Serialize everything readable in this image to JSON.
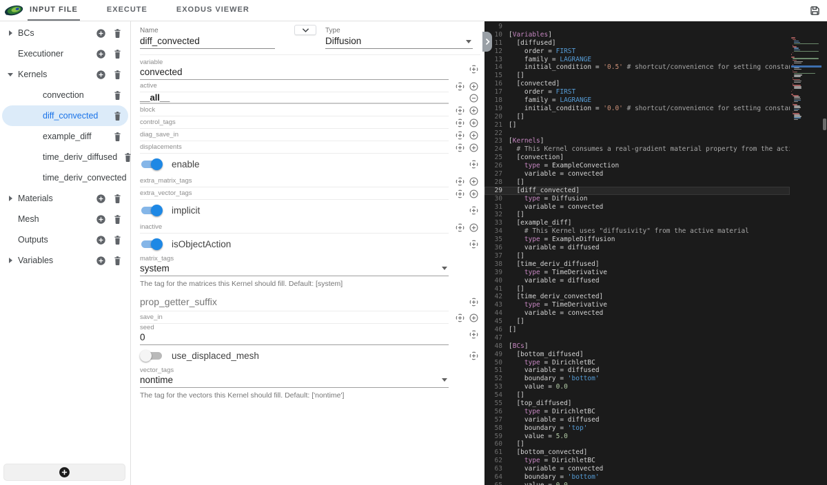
{
  "toolbar": {
    "tabs": [
      {
        "label": "INPUT FILE",
        "active": true
      },
      {
        "label": "EXECUTE",
        "active": false
      },
      {
        "label": "EXODUS VIEWER",
        "active": false
      }
    ],
    "save_icon": "save-icon"
  },
  "sidebar": {
    "items": [
      {
        "label": "BCs",
        "level": 0,
        "arrow": "right",
        "add": true,
        "trash": true,
        "selected": false
      },
      {
        "label": "Executioner",
        "level": 0,
        "arrow": null,
        "add": true,
        "trash": true,
        "selected": false
      },
      {
        "label": "Kernels",
        "level": 0,
        "arrow": "down",
        "add": true,
        "trash": true,
        "selected": false
      },
      {
        "label": "convection",
        "level": 1,
        "arrow": null,
        "add": false,
        "trash": true,
        "selected": false
      },
      {
        "label": "diff_convected",
        "level": 1,
        "arrow": null,
        "add": false,
        "trash": true,
        "selected": true
      },
      {
        "label": "example_diff",
        "level": 1,
        "arrow": null,
        "add": false,
        "trash": true,
        "selected": false
      },
      {
        "label": "time_deriv_diffused",
        "level": 1,
        "arrow": null,
        "add": false,
        "trash": true,
        "selected": false
      },
      {
        "label": "time_deriv_convected",
        "level": 1,
        "arrow": null,
        "add": false,
        "trash": true,
        "selected": false
      },
      {
        "label": "Materials",
        "level": 0,
        "arrow": "right",
        "add": true,
        "trash": true,
        "selected": false
      },
      {
        "label": "Mesh",
        "level": 0,
        "arrow": null,
        "add": true,
        "trash": true,
        "selected": false
      },
      {
        "label": "Outputs",
        "level": 0,
        "arrow": null,
        "add": true,
        "trash": true,
        "selected": false
      },
      {
        "label": "Variables",
        "level": 0,
        "arrow": "right",
        "add": true,
        "trash": true,
        "selected": false
      }
    ],
    "selected_color": "#1a73e8",
    "selected_bg": "#dcebf9"
  },
  "form": {
    "name": {
      "label": "Name",
      "value": "diff_convected"
    },
    "type": {
      "label": "Type",
      "value": "Diffusion"
    },
    "rows": [
      {
        "kind": "filled",
        "label": "variable",
        "value": "convected",
        "icons": [
          "target"
        ]
      },
      {
        "kind": "empty",
        "label": "active",
        "icons": [
          "target",
          "add"
        ]
      },
      {
        "kind": "item",
        "value": "__all__",
        "icons": [
          "remove"
        ]
      },
      {
        "kind": "empty",
        "label": "block",
        "icons": [
          "target",
          "add"
        ]
      },
      {
        "kind": "empty",
        "label": "control_tags",
        "icons": [
          "target",
          "add"
        ]
      },
      {
        "kind": "empty",
        "label": "diag_save_in",
        "icons": [
          "target",
          "add"
        ]
      },
      {
        "kind": "empty",
        "label": "displacements",
        "icons": [
          "target",
          "add"
        ]
      },
      {
        "kind": "toggle",
        "label": "enable",
        "on": true,
        "icons": [
          "target"
        ]
      },
      {
        "kind": "empty",
        "label": "extra_matrix_tags",
        "icons": [
          "target",
          "add"
        ]
      },
      {
        "kind": "empty",
        "label": "extra_vector_tags",
        "icons": [
          "target",
          "add"
        ]
      },
      {
        "kind": "toggle",
        "label": "implicit",
        "on": true,
        "icons": [
          "target"
        ]
      },
      {
        "kind": "empty",
        "label": "inactive",
        "icons": [
          "target",
          "add"
        ]
      },
      {
        "kind": "toggle",
        "label": "isObjectAction",
        "on": true,
        "icons": [
          "target"
        ]
      },
      {
        "kind": "select",
        "label": "matrix_tags",
        "value": "system",
        "helper": "The tag for the matrices this Kernel should fill. Default: [system]",
        "icons": []
      },
      {
        "kind": "placeholder",
        "label": "prop_getter_suffix",
        "icons": [
          "target"
        ]
      },
      {
        "kind": "empty",
        "label": "save_in",
        "icons": [
          "target",
          "add"
        ]
      },
      {
        "kind": "filled",
        "label": "seed",
        "value": "0",
        "icons": [
          "target"
        ]
      },
      {
        "kind": "toggle",
        "label": "use_displaced_mesh",
        "on": false,
        "icons": [
          "target"
        ]
      },
      {
        "kind": "select",
        "label": "vector_tags",
        "value": "nontime",
        "helper": "The tag for the vectors this Kernel should fill. Default: ['nontime']",
        "icons": []
      }
    ],
    "toggle_on_color": "#1e88e5"
  },
  "editor": {
    "background": "#1b1b1b",
    "current_line": 29,
    "token_colors": {
      "d": "#d4d4d4",
      "p": "#c586c0",
      "b": "#569cd6",
      "o": "#ce9178",
      "n": "#b5cea8",
      "c": "#a8a8a8"
    },
    "lines": [
      {
        "n": 9,
        "t": []
      },
      {
        "n": 10,
        "t": [
          [
            "[",
            "d"
          ],
          [
            "Variables",
            "p"
          ],
          [
            "]",
            "d"
          ]
        ]
      },
      {
        "n": 11,
        "t": [
          [
            "  [diffused]",
            "d"
          ]
        ]
      },
      {
        "n": 12,
        "t": [
          [
            "    order = ",
            "d"
          ],
          [
            "FIRST",
            "b"
          ]
        ]
      },
      {
        "n": 13,
        "t": [
          [
            "    family = ",
            "d"
          ],
          [
            "LAGRANGE",
            "b"
          ]
        ]
      },
      {
        "n": 14,
        "t": [
          [
            "    initial_condition = ",
            "d"
          ],
          [
            "'0.5'",
            "o"
          ],
          [
            " ",
            "d"
          ],
          [
            "# shortcut/convenience for setting constant initial condition",
            "c"
          ]
        ]
      },
      {
        "n": 15,
        "t": [
          [
            "  []",
            "d"
          ]
        ]
      },
      {
        "n": 16,
        "t": [
          [
            "  [convected]",
            "d"
          ]
        ]
      },
      {
        "n": 17,
        "t": [
          [
            "    order = ",
            "d"
          ],
          [
            "FIRST",
            "b"
          ]
        ]
      },
      {
        "n": 18,
        "t": [
          [
            "    family = ",
            "d"
          ],
          [
            "LAGRANGE",
            "b"
          ]
        ]
      },
      {
        "n": 19,
        "t": [
          [
            "    initial_condition = ",
            "d"
          ],
          [
            "'0.0'",
            "o"
          ],
          [
            " ",
            "d"
          ],
          [
            "# shortcut/convenience for setting constant initial condition",
            "c"
          ]
        ]
      },
      {
        "n": 20,
        "t": [
          [
            "  []",
            "d"
          ]
        ]
      },
      {
        "n": 21,
        "t": [
          [
            "[]",
            "d"
          ]
        ]
      },
      {
        "n": 22,
        "t": []
      },
      {
        "n": 23,
        "t": [
          [
            "[",
            "d"
          ],
          [
            "Kernels",
            "p"
          ],
          [
            "]",
            "d"
          ]
        ]
      },
      {
        "n": 24,
        "t": [
          [
            "  ",
            "d"
          ],
          [
            "# This Kernel consumes a real-gradient material property from the active material",
            "c"
          ]
        ]
      },
      {
        "n": 25,
        "t": [
          [
            "  [convection]",
            "d"
          ]
        ]
      },
      {
        "n": 26,
        "t": [
          [
            "    ",
            "d"
          ],
          [
            "type",
            "p"
          ],
          [
            " = ExampleConvection",
            "d"
          ]
        ]
      },
      {
        "n": 27,
        "t": [
          [
            "    variable = convected",
            "d"
          ]
        ]
      },
      {
        "n": 28,
        "t": [
          [
            "  []",
            "d"
          ]
        ]
      },
      {
        "n": 29,
        "t": [
          [
            "  [diff_convected]",
            "d"
          ]
        ]
      },
      {
        "n": 30,
        "t": [
          [
            "    ",
            "d"
          ],
          [
            "type",
            "p"
          ],
          [
            " = Diffusion",
            "d"
          ]
        ]
      },
      {
        "n": 31,
        "t": [
          [
            "    variable = convected",
            "d"
          ]
        ]
      },
      {
        "n": 32,
        "t": [
          [
            "  []",
            "d"
          ]
        ]
      },
      {
        "n": 33,
        "t": [
          [
            "  [example_diff]",
            "d"
          ]
        ]
      },
      {
        "n": 34,
        "t": [
          [
            "    ",
            "d"
          ],
          [
            "# This Kernel uses \"diffusivity\" from the active material",
            "c"
          ]
        ]
      },
      {
        "n": 35,
        "t": [
          [
            "    ",
            "d"
          ],
          [
            "type",
            "p"
          ],
          [
            " = ExampleDiffusion",
            "d"
          ]
        ]
      },
      {
        "n": 36,
        "t": [
          [
            "    variable = diffused",
            "d"
          ]
        ]
      },
      {
        "n": 37,
        "t": [
          [
            "  []",
            "d"
          ]
        ]
      },
      {
        "n": 38,
        "t": [
          [
            "  [time_deriv_diffused]",
            "d"
          ]
        ]
      },
      {
        "n": 39,
        "t": [
          [
            "    ",
            "d"
          ],
          [
            "type",
            "p"
          ],
          [
            " = TimeDerivative",
            "d"
          ]
        ]
      },
      {
        "n": 40,
        "t": [
          [
            "    variable = diffused",
            "d"
          ]
        ]
      },
      {
        "n": 41,
        "t": [
          [
            "  []",
            "d"
          ]
        ]
      },
      {
        "n": 42,
        "t": [
          [
            "  [time_deriv_convected]",
            "d"
          ]
        ]
      },
      {
        "n": 43,
        "t": [
          [
            "    ",
            "d"
          ],
          [
            "type",
            "p"
          ],
          [
            " = TimeDerivative",
            "d"
          ]
        ]
      },
      {
        "n": 44,
        "t": [
          [
            "    variable = convected",
            "d"
          ]
        ]
      },
      {
        "n": 45,
        "t": [
          [
            "  []",
            "d"
          ]
        ]
      },
      {
        "n": 46,
        "t": [
          [
            "[]",
            "d"
          ]
        ]
      },
      {
        "n": 47,
        "t": []
      },
      {
        "n": 48,
        "t": [
          [
            "[",
            "d"
          ],
          [
            "BCs",
            "p"
          ],
          [
            "]",
            "d"
          ]
        ]
      },
      {
        "n": 49,
        "t": [
          [
            "  [bottom_diffused]",
            "d"
          ]
        ]
      },
      {
        "n": 50,
        "t": [
          [
            "    ",
            "d"
          ],
          [
            "type",
            "p"
          ],
          [
            " = DirichletBC",
            "d"
          ]
        ]
      },
      {
        "n": 51,
        "t": [
          [
            "    variable = diffused",
            "d"
          ]
        ]
      },
      {
        "n": 52,
        "t": [
          [
            "    boundary = ",
            "d"
          ],
          [
            "'bottom'",
            "b"
          ]
        ]
      },
      {
        "n": 53,
        "t": [
          [
            "    value = ",
            "d"
          ],
          [
            "0.0",
            "n"
          ]
        ]
      },
      {
        "n": 54,
        "t": [
          [
            "  []",
            "d"
          ]
        ]
      },
      {
        "n": 55,
        "t": [
          [
            "  [top_diffused]",
            "d"
          ]
        ]
      },
      {
        "n": 56,
        "t": [
          [
            "    ",
            "d"
          ],
          [
            "type",
            "p"
          ],
          [
            " = DirichletBC",
            "d"
          ]
        ]
      },
      {
        "n": 57,
        "t": [
          [
            "    variable = diffused",
            "d"
          ]
        ]
      },
      {
        "n": 58,
        "t": [
          [
            "    boundary = ",
            "d"
          ],
          [
            "'top'",
            "b"
          ]
        ]
      },
      {
        "n": 59,
        "t": [
          [
            "    value = ",
            "d"
          ],
          [
            "5.0",
            "n"
          ]
        ]
      },
      {
        "n": 60,
        "t": [
          [
            "  []",
            "d"
          ]
        ]
      },
      {
        "n": 61,
        "t": [
          [
            "  [bottom_convected]",
            "d"
          ]
        ]
      },
      {
        "n": 62,
        "t": [
          [
            "    ",
            "d"
          ],
          [
            "type",
            "p"
          ],
          [
            " = DirichletBC",
            "d"
          ]
        ]
      },
      {
        "n": 63,
        "t": [
          [
            "    variable = convected",
            "d"
          ]
        ]
      },
      {
        "n": 64,
        "t": [
          [
            "    boundary = ",
            "d"
          ],
          [
            "'bottom'",
            "b"
          ]
        ]
      },
      {
        "n": 65,
        "t": [
          [
            "    value = ",
            "d"
          ],
          [
            "0.0",
            "n"
          ]
        ]
      }
    ]
  }
}
